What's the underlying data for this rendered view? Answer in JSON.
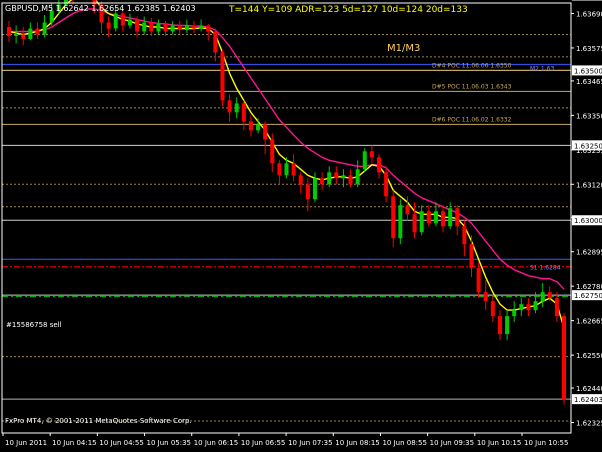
{
  "window": {
    "symbol_info": "GBPUSD,M5  1.62642 1.62654 1.62385 1.62403",
    "stats": "T=144  Y=109  ADR=123  5d=127  10d=124  20d=133",
    "m_label": "M1/M3",
    "copyright": "FxPro MT4, © 2001-2011 MetaQuotes Software Corp.",
    "order_label": "#15586758 sell"
  },
  "colors": {
    "background": "#000000",
    "axis": "#ffffff",
    "bull": "#00cc00",
    "bear": "#ff0000",
    "ma_fast": "#ffff00",
    "ma_slow": "#ff1493",
    "level_line": "#c8a85a",
    "poc_line": "#c8a85a",
    "blue_level": "#3a5aff",
    "order_line": "#00c800",
    "pivot_line": "#ff0000",
    "bid_line": "#b4b4b4",
    "current_price_box": "#ff0000"
  },
  "chart_data": {
    "type": "candlestick",
    "symbol": "GBPUSD",
    "timeframe": "M5",
    "ylim": [
      1.6229,
      1.63725
    ],
    "y_ticks": [
      "1.63690",
      "1.63575",
      "1.63465",
      "1.63350",
      "1.63235",
      "1.63120",
      "1.63010",
      "1.62895",
      "1.62780",
      "1.62665",
      "1.62550",
      "1.62440",
      "1.62325"
    ],
    "y_tick_values": [
      1.6369,
      1.63575,
      1.63465,
      1.6335,
      1.63235,
      1.6312,
      1.6301,
      1.62895,
      1.6278,
      1.62665,
      1.6255,
      1.6244,
      1.62325
    ],
    "x_ticks": [
      "10 Jun 2011",
      "10 Jun 04:15",
      "10 Jun 04:55",
      "10 Jun 05:35",
      "10 Jun 06:15",
      "10 Jun 06:55",
      "10 Jun 07:35",
      "10 Jun 08:15",
      "10 Jun 08:55",
      "10 Jun 09:35",
      "10 Jun 10:15",
      "10 Jun 10:55"
    ],
    "price_tags": [
      {
        "label": "1.63750",
        "value": 1.6375,
        "style": "level"
      },
      {
        "label": "1.63500",
        "value": 1.635,
        "style": "level"
      },
      {
        "label": "1.63250",
        "value": 1.6325,
        "style": "level"
      },
      {
        "label": "1.63000",
        "value": 1.63,
        "style": "level"
      },
      {
        "label": "1.62750",
        "value": 1.6275,
        "style": "level"
      },
      {
        "label": "1.62403",
        "value": 1.62403,
        "style": "current"
      }
    ],
    "pivot_labels": [
      {
        "label": "M2 1.63",
        "value": 1.6351
      },
      {
        "label": "S1 1.6284",
        "value": 1.62845
      }
    ],
    "poc_lines": [
      {
        "label": "D#4 POC 11.06.06 1.6350",
        "value": 1.635
      },
      {
        "label": "D#5 POC 11.06.03 1.6343",
        "value": 1.6343
      },
      {
        "label": "D#6 POC 11.06.02 1.6332",
        "value": 1.6332
      }
    ],
    "m_level": 1.6375,
    "order_level": 1.62745,
    "dashed_levels": [
      1.6379,
      1.6362,
      1.63545,
      1.63375,
      1.6312,
      1.63045,
      1.62545,
      1.6233
    ],
    "blue_levels": [
      1.6352,
      1.6287
    ],
    "red_level": 1.62845,
    "candles": [
      [
        1.63645,
        1.63615,
        1.63665,
        1.63595
      ],
      [
        1.63615,
        1.6362,
        1.6365,
        1.6359
      ],
      [
        1.6362,
        1.63605,
        1.63645,
        1.63585
      ],
      [
        1.63605,
        1.6364,
        1.6366,
        1.636
      ],
      [
        1.6364,
        1.6362,
        1.6366,
        1.63605
      ],
      [
        1.6362,
        1.6366,
        1.63685,
        1.6361
      ],
      [
        1.6366,
        1.637,
        1.63725,
        1.6365
      ],
      [
        1.637,
        1.6372,
        1.6374,
        1.6369
      ],
      [
        1.6372,
        1.6377,
        1.6379,
        1.63715
      ],
      [
        1.6377,
        1.6375,
        1.6379,
        1.6372
      ],
      [
        1.6375,
        1.6379,
        1.6381,
        1.6374
      ],
      [
        1.6379,
        1.6377,
        1.6381,
        1.63745
      ],
      [
        1.6377,
        1.6372,
        1.6378,
        1.6369
      ],
      [
        1.6372,
        1.6366,
        1.6373,
        1.63625
      ],
      [
        1.6366,
        1.6364,
        1.6368,
        1.6361
      ],
      [
        1.6364,
        1.6369,
        1.6371,
        1.6363
      ],
      [
        1.6369,
        1.6365,
        1.637,
        1.6363
      ],
      [
        1.6365,
        1.6367,
        1.6369,
        1.6364
      ],
      [
        1.6367,
        1.6363,
        1.6368,
        1.6361
      ],
      [
        1.6363,
        1.6366,
        1.6368,
        1.6362
      ],
      [
        1.6366,
        1.6363,
        1.63675,
        1.63615
      ],
      [
        1.6363,
        1.63655,
        1.6367,
        1.6362
      ],
      [
        1.63655,
        1.6363,
        1.63665,
        1.63615
      ],
      [
        1.6363,
        1.6365,
        1.63665,
        1.6362
      ],
      [
        1.6365,
        1.63635,
        1.63665,
        1.6362
      ],
      [
        1.63635,
        1.6365,
        1.6367,
        1.63625
      ],
      [
        1.6365,
        1.6364,
        1.63665,
        1.63625
      ],
      [
        1.6364,
        1.6365,
        1.6367,
        1.6363
      ],
      [
        1.6365,
        1.6363,
        1.63655,
        1.636
      ],
      [
        1.6363,
        1.6356,
        1.6364,
        1.6353
      ],
      [
        1.6356,
        1.634,
        1.6357,
        1.6338
      ],
      [
        1.634,
        1.6336,
        1.6342,
        1.6333
      ],
      [
        1.6336,
        1.6339,
        1.6341,
        1.6334
      ],
      [
        1.6339,
        1.6333,
        1.634,
        1.633
      ],
      [
        1.6333,
        1.633,
        1.6335,
        1.6328
      ],
      [
        1.633,
        1.6332,
        1.6334,
        1.6329
      ],
      [
        1.6332,
        1.6327,
        1.6333,
        1.6322
      ],
      [
        1.6327,
        1.6319,
        1.6329,
        1.6316
      ],
      [
        1.6319,
        1.6315,
        1.632,
        1.6312
      ],
      [
        1.6315,
        1.6319,
        1.6321,
        1.6314
      ],
      [
        1.6319,
        1.6315,
        1.6322,
        1.6313
      ],
      [
        1.6315,
        1.6312,
        1.6316,
        1.6309
      ],
      [
        1.6312,
        1.6307,
        1.6314,
        1.6303
      ],
      [
        1.6307,
        1.6314,
        1.6316,
        1.6306
      ],
      [
        1.6314,
        1.6312,
        1.6316,
        1.631
      ],
      [
        1.6312,
        1.6316,
        1.6318,
        1.6311
      ],
      [
        1.6316,
        1.6314,
        1.6318,
        1.6312
      ],
      [
        1.6314,
        1.6315,
        1.6317,
        1.6311
      ],
      [
        1.6315,
        1.6312,
        1.6317,
        1.6311
      ],
      [
        1.6312,
        1.6317,
        1.632,
        1.6311
      ],
      [
        1.6317,
        1.6323,
        1.6324,
        1.6316
      ],
      [
        1.6323,
        1.6321,
        1.6325,
        1.6319
      ],
      [
        1.6321,
        1.6316,
        1.6322,
        1.6314
      ],
      [
        1.6316,
        1.6308,
        1.6318,
        1.6306
      ],
      [
        1.6308,
        1.6294,
        1.631,
        1.6291
      ],
      [
        1.6294,
        1.6305,
        1.6307,
        1.6292
      ],
      [
        1.6305,
        1.6302,
        1.6308,
        1.63
      ],
      [
        1.6302,
        1.6296,
        1.6306,
        1.6294
      ],
      [
        1.6296,
        1.6303,
        1.6305,
        1.6295
      ],
      [
        1.6303,
        1.6299,
        1.6305,
        1.6298
      ],
      [
        1.6299,
        1.6303,
        1.6306,
        1.6298
      ],
      [
        1.6303,
        1.6298,
        1.6305,
        1.6296
      ],
      [
        1.6298,
        1.6304,
        1.6306,
        1.6297
      ],
      [
        1.6304,
        1.6298,
        1.6305,
        1.6295
      ],
      [
        1.6298,
        1.6292,
        1.63,
        1.6288
      ],
      [
        1.6292,
        1.6284,
        1.6295,
        1.6281
      ],
      [
        1.6284,
        1.6276,
        1.6286,
        1.6274
      ],
      [
        1.6276,
        1.6273,
        1.628,
        1.627
      ],
      [
        1.6273,
        1.6268,
        1.6275,
        1.6266
      ],
      [
        1.6268,
        1.6262,
        1.627,
        1.626
      ],
      [
        1.6262,
        1.6268,
        1.627,
        1.626
      ],
      [
        1.6268,
        1.627,
        1.6273,
        1.6266
      ],
      [
        1.627,
        1.6272,
        1.6274,
        1.6268
      ],
      [
        1.6272,
        1.627,
        1.6274,
        1.6268
      ],
      [
        1.627,
        1.6273,
        1.6276,
        1.6269
      ],
      [
        1.6273,
        1.6276,
        1.6279,
        1.6271
      ],
      [
        1.6276,
        1.6274,
        1.6278,
        1.6273
      ],
      [
        1.6274,
        1.6268,
        1.6276,
        1.6266
      ],
      [
        1.6268,
        1.624,
        1.6269,
        1.62385
      ]
    ],
    "ma_fast": [
      1.6363,
      1.63625,
      1.6362,
      1.63625,
      1.6363,
      1.6364,
      1.6366,
      1.6369,
      1.6372,
      1.6374,
      1.6376,
      1.6376,
      1.6374,
      1.6371,
      1.6369,
      1.6368,
      1.6367,
      1.63665,
      1.63655,
      1.6365,
      1.63645,
      1.63645,
      1.6364,
      1.6364,
      1.6364,
      1.6364,
      1.6364,
      1.63642,
      1.6364,
      1.6362,
      1.6356,
      1.6349,
      1.6344,
      1.634,
      1.6336,
      1.6333,
      1.633,
      1.6326,
      1.6322,
      1.632,
      1.6319,
      1.6317,
      1.6315,
      1.6314,
      1.63135,
      1.6314,
      1.63145,
      1.63145,
      1.6314,
      1.63145,
      1.63165,
      1.63185,
      1.6318,
      1.6315,
      1.631,
      1.6308,
      1.6306,
      1.6303,
      1.6302,
      1.6302,
      1.6302,
      1.6301,
      1.6301,
      1.63005,
      1.6298,
      1.6293,
      1.6287,
      1.6281,
      1.6276,
      1.6272,
      1.627,
      1.627,
      1.62705,
      1.6271,
      1.62715,
      1.6273,
      1.6274,
      1.6272,
      1.6264
    ],
    "ma_slow": [
      1.6363,
      1.6363,
      1.6363,
      1.6363,
      1.63632,
      1.63635,
      1.63645,
      1.6366,
      1.63675,
      1.6369,
      1.637,
      1.63705,
      1.63705,
      1.637,
      1.6369,
      1.63685,
      1.6368,
      1.63675,
      1.6367,
      1.63665,
      1.6366,
      1.63657,
      1.63655,
      1.63652,
      1.6365,
      1.6365,
      1.63648,
      1.63648,
      1.63645,
      1.63635,
      1.6361,
      1.6358,
      1.63545,
      1.6351,
      1.63475,
      1.6344,
      1.63405,
      1.6337,
      1.63335,
      1.6331,
      1.63285,
      1.6326,
      1.6324,
      1.63225,
      1.6321,
      1.632,
      1.63195,
      1.6319,
      1.63185,
      1.6318,
      1.6318,
      1.63185,
      1.63185,
      1.63175,
      1.6315,
      1.6313,
      1.6311,
      1.6309,
      1.63075,
      1.63065,
      1.63055,
      1.63045,
      1.63035,
      1.63025,
      1.6301,
      1.6299,
      1.6296,
      1.6293,
      1.629,
      1.6287,
      1.6285,
      1.62835,
      1.62825,
      1.62815,
      1.6281,
      1.62805,
      1.62805,
      1.62795,
      1.6277
    ]
  }
}
